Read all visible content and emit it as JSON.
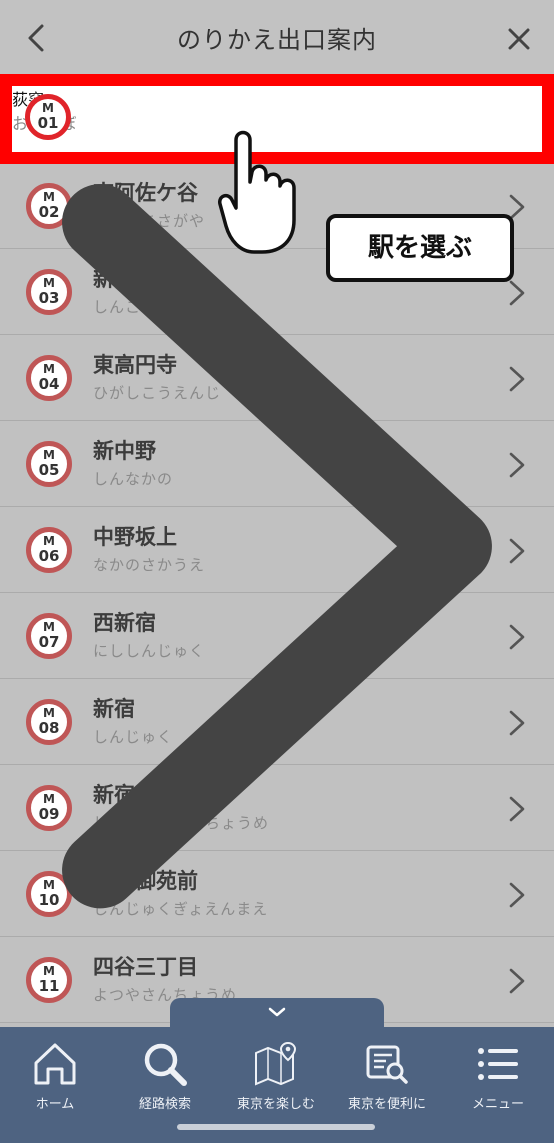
{
  "header": {
    "title": "のりかえ出口案内"
  },
  "selected": {
    "code_line": "M",
    "code_num": "01",
    "name": "荻窪",
    "kana": "おぎくぼ"
  },
  "stations": [
    {
      "code_line": "M",
      "code_num": "02",
      "name": "南阿佐ケ谷",
      "kana": "みなみあさがや"
    },
    {
      "code_line": "M",
      "code_num": "03",
      "name": "新高円寺",
      "kana": "しんこうえんじ"
    },
    {
      "code_line": "M",
      "code_num": "04",
      "name": "東高円寺",
      "kana": "ひがしこうえんじ"
    },
    {
      "code_line": "M",
      "code_num": "05",
      "name": "新中野",
      "kana": "しんなかの"
    },
    {
      "code_line": "M",
      "code_num": "06",
      "name": "中野坂上",
      "kana": "なかのさかうえ"
    },
    {
      "code_line": "M",
      "code_num": "07",
      "name": "西新宿",
      "kana": "にししんじゅく"
    },
    {
      "code_line": "M",
      "code_num": "08",
      "name": "新宿",
      "kana": "しんじゅく"
    },
    {
      "code_line": "M",
      "code_num": "09",
      "name": "新宿三丁目",
      "kana": "しんじゅくさんちょうめ"
    },
    {
      "code_line": "M",
      "code_num": "10",
      "name": "新宿御苑前",
      "kana": "しんじゅくぎょえんまえ"
    },
    {
      "code_line": "M",
      "code_num": "11",
      "name": "四谷三丁目",
      "kana": "よつやさんちょうめ"
    }
  ],
  "callout": {
    "text": "駅を選ぶ"
  },
  "tabs": [
    {
      "label": "ホーム",
      "icon": "home-icon"
    },
    {
      "label": "経路検索",
      "icon": "search-icon"
    },
    {
      "label": "東京を楽しむ",
      "icon": "map-icon"
    },
    {
      "label": "東京を便利に",
      "icon": "guide-search-icon"
    },
    {
      "label": "メニュー",
      "icon": "menu-icon"
    }
  ],
  "colors": {
    "line_red": "#e0242a",
    "highlight_border": "#ff0000",
    "tabbar": "#4e6381"
  }
}
